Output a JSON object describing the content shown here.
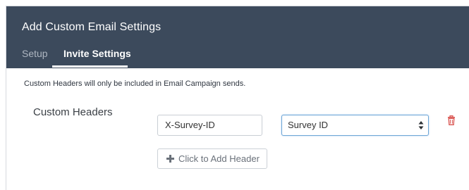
{
  "dialog": {
    "title": "Add Custom Email Settings",
    "tabs": [
      {
        "label": "Setup",
        "active": false
      },
      {
        "label": "Invite Settings",
        "active": true
      }
    ]
  },
  "info_text": "Custom Headers will only be included in Email Campaign sends.",
  "custom_headers": {
    "section_label": "Custom Headers",
    "rows": [
      {
        "header_name": "X-Survey-ID",
        "value_select": "Survey ID"
      }
    ],
    "add_button_label": "Click to Add Header"
  },
  "colors": {
    "header_bg": "#3c4a5c",
    "delete_icon": "#d9534f",
    "select_focus": "#6ea6d6"
  },
  "icons": {
    "delete": "trash-icon",
    "add": "plus-icon",
    "select_caret": "sort-caret-icon"
  }
}
